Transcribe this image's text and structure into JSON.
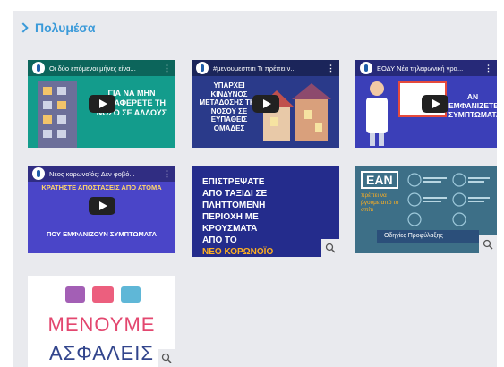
{
  "section": {
    "title": "Πολυμέσα"
  },
  "videos": [
    {
      "title": "Οι δύο επόμενοι μήνες είνα...",
      "caption": "ΓΙΑ ΝΑ ΜΗΝ ΜΕΤΑΦΕΡΕΤΕ ΤΗ ΝΟΣΟ ΣΕ ΑΛΛΟΥΣ"
    },
    {
      "title": "#μενουμεσπιτι Τι πρέπει ν...",
      "caption": "ΥΠΑΡΧΕΙ ΚΙΝΔΥΝΟΣ ΜΕΤΑΔΟΣΗΣ ΤΗΣ ΝΟΣΟΥ ΣΕ ΕΥΠΑΘΕΙΣ ΟΜΑΔΕΣ"
    },
    {
      "title": "ΕΟΔΥ Νέα τηλεφωνική γρα...",
      "caption": "ΑΝ ΕΜΦΑΝΙΖΕΤΕ ΣΥΜΠΤΩΜΑΤΑ"
    },
    {
      "title": "Νέος κορωνοϊός: Δεν φοβό...",
      "caption_top": "ΚΡΑΤΗΣΤΕ ΑΠΟΣΤΑΣΕΙΣ ΑΠΟ ΑΤΟΜΑ",
      "caption": "ΠΟΥ ΕΜΦΑΝΙΖΟΥΝ ΣΥΜΠΤΩΜΑΤΑ"
    }
  ],
  "posters": [
    {
      "lines": [
        "ΕΠΙΣΤΡΕΨΑΤΕ",
        "ΑΠΟ ΤΑΞΙΔΙ ΣΕ",
        "ΠΛΗΤΤΟΜΕΝΗ",
        "ΠΕΡΙΟΧΗ ΜΕ",
        "ΚΡΟΥΣΜΑΤΑ",
        "ΑΠΟ ΤΟ"
      ],
      "highlight": "ΝΕΟ ΚΟΡΩΝΟΪΟ"
    },
    {
      "heading": "ΕΑΝ",
      "sub": "πρέπει να βγούμε από το σπίτι",
      "banner": "Οδηγίες Προφύλαξης"
    },
    {
      "lines": [
        "ΜΕΝΟΥΜΕ",
        "ΑΣΦΑΛΕΙΣ"
      ]
    }
  ],
  "colors": {
    "accent": "#3a9ad9",
    "panel": "#e9eaee"
  },
  "icons": {
    "section": "chevron-right-icon",
    "zoom": "magnifier-icon",
    "play": "play-icon",
    "menu": "kebab-menu-icon"
  }
}
